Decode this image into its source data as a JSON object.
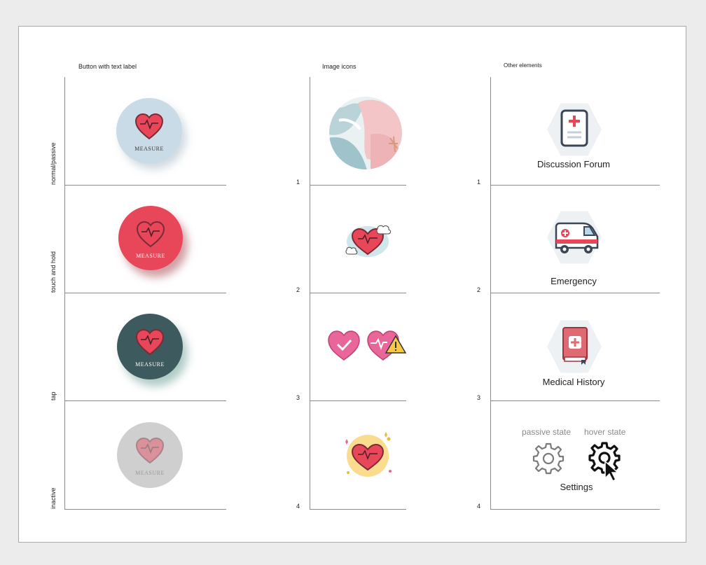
{
  "columns": {
    "buttons_title": "Button with text label",
    "images_title": "Image icons",
    "other_title": "Other elements"
  },
  "row_states": [
    "normal/passive",
    "touch and hold",
    "tap",
    "inactive"
  ],
  "row_numbers": [
    "1",
    "2",
    "3",
    "4"
  ],
  "button": {
    "label": "MEASURE",
    "states": [
      {
        "name": "normal",
        "bg": "#c9dbe6",
        "text_color": "#3a3a3a"
      },
      {
        "name": "touch-and-hold",
        "bg": "#e8475a",
        "text_color": "#ffffff"
      },
      {
        "name": "tap",
        "bg": "#3d5a5e",
        "text_color": "#ffffff"
      },
      {
        "name": "inactive",
        "bg": "#cfcfcf",
        "text_color": "#9a9a9a"
      }
    ]
  },
  "image_icons": [
    "abstract-pastel-circle-icon",
    "heart-clouds-icon",
    "heart-check-and-heart-warning-icon",
    "heart-sparkles-icon"
  ],
  "other_elements": {
    "discussion_forum": "Discussion Forum",
    "emergency": "Emergency",
    "medical_history": "Medical History",
    "passive_state": "passive state",
    "hover_state": "hover state",
    "settings": "Settings"
  },
  "colors": {
    "heart": "#e8475a",
    "heart_outline": "#7a2b36",
    "hex_bg": "#eef1f4"
  }
}
